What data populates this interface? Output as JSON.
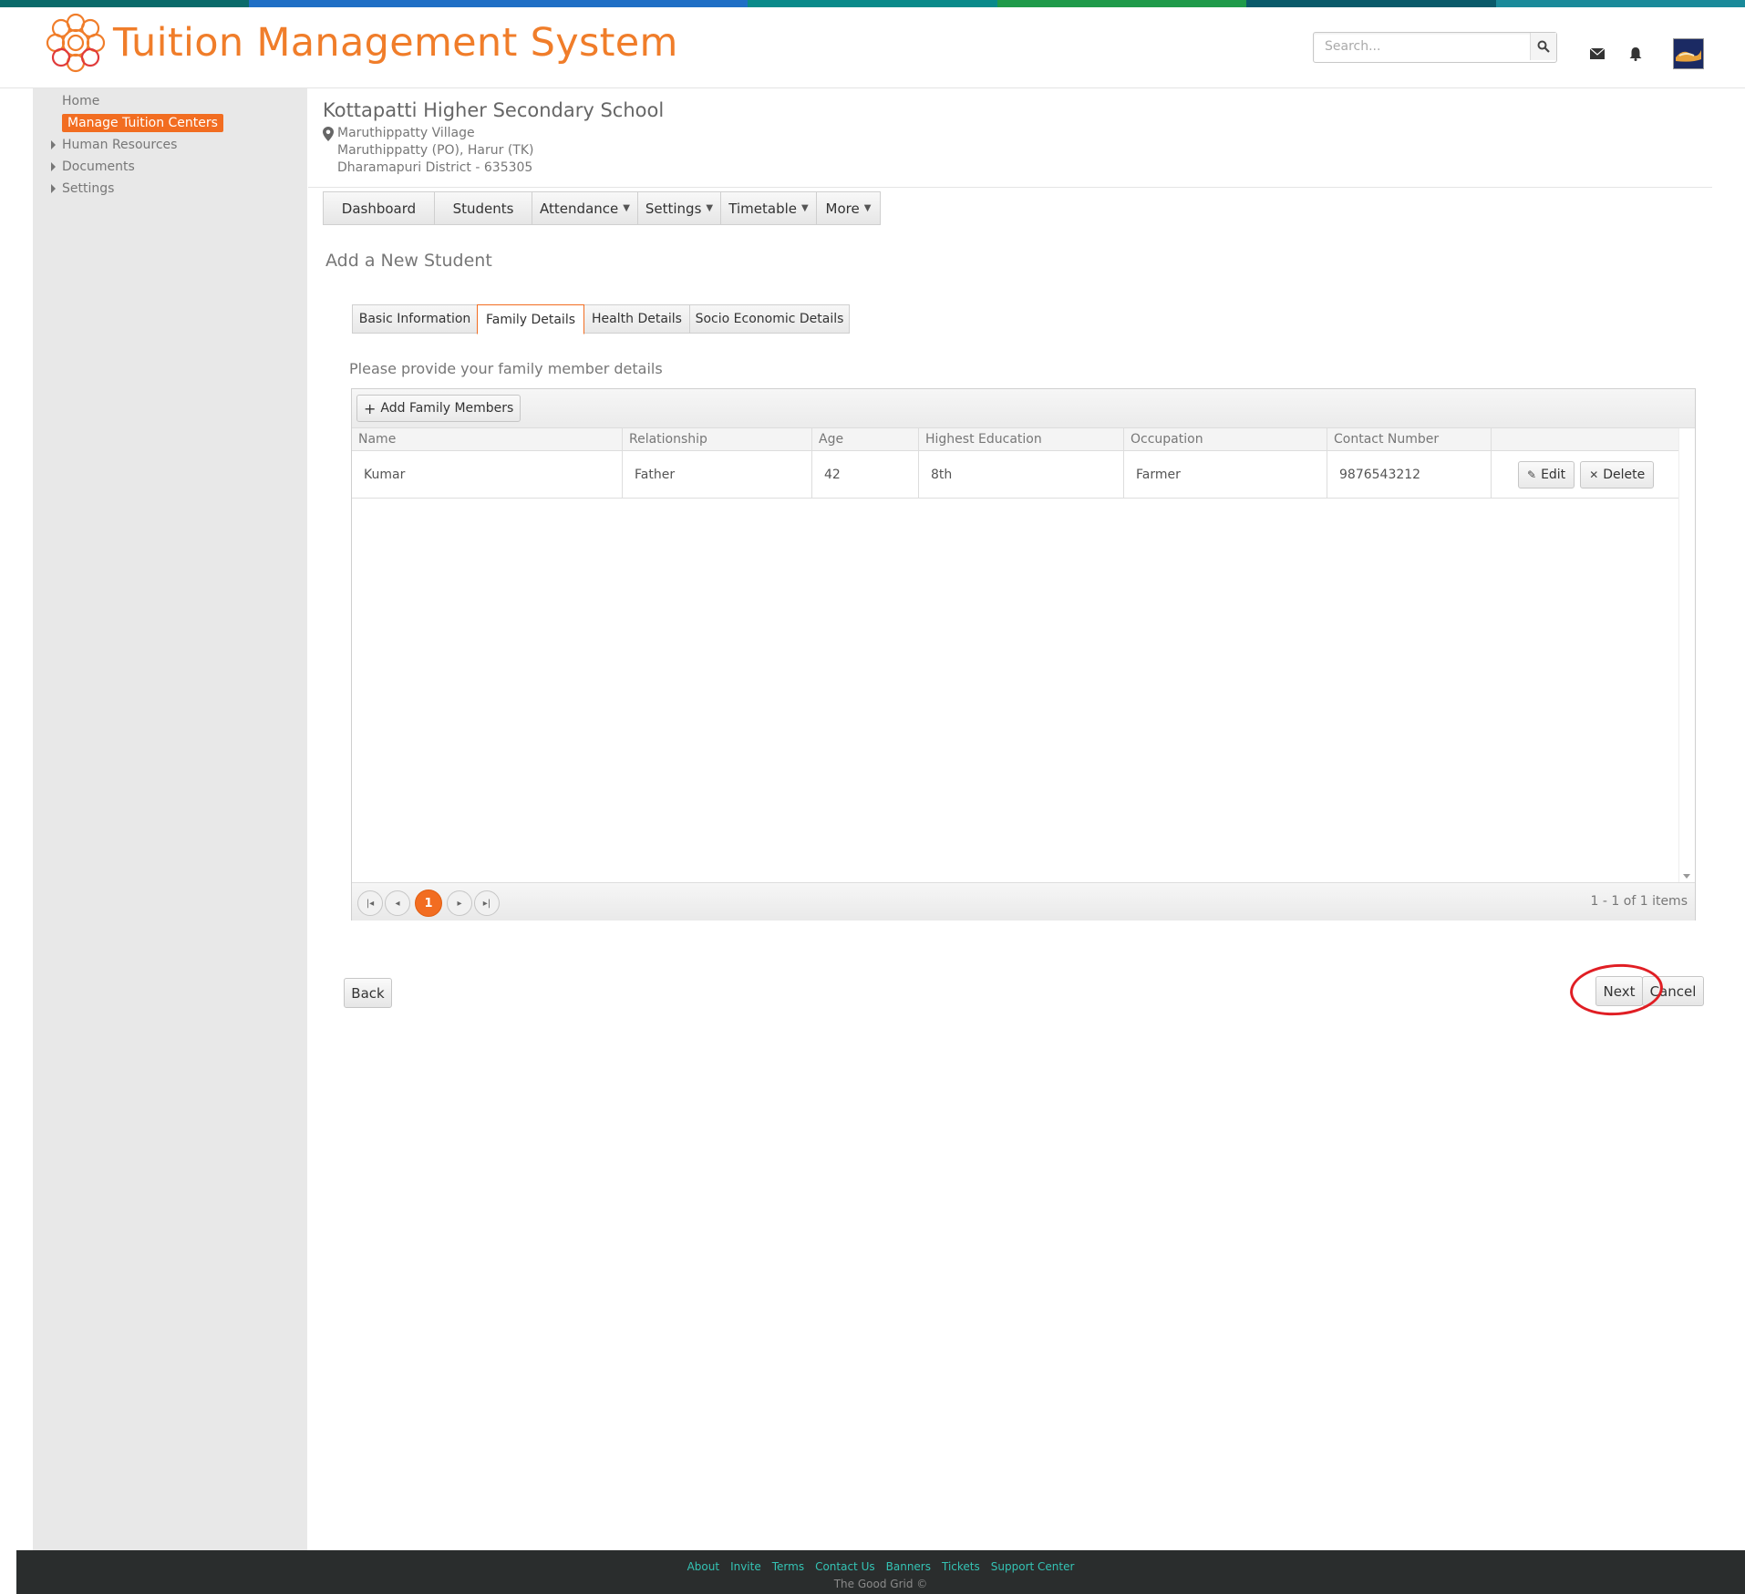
{
  "colors": {
    "accent": "#f26d21",
    "title": "#f07d2a",
    "topbar": [
      "#0a6a6a",
      "#1f6fc5",
      "#1f6fc5",
      "#0a8a8a",
      "#1f9a4a",
      "#0a5a6a",
      "#1a8a9a"
    ],
    "footer_link": "#34c3b4",
    "annotation": "#e01e24"
  },
  "header": {
    "app_title": "Tuition Management System",
    "logo_icon": "flower-logo-icon",
    "search_placeholder": "Search...",
    "search_icon": "search-icon",
    "mail_icon": "envelope-icon",
    "bell_icon": "bell-icon",
    "avatar_icon": "user-avatar"
  },
  "sidebar": {
    "home": "Home",
    "active": "Manage Tuition  Centers",
    "items": [
      "Human Resources",
      "Documents",
      "Settings"
    ]
  },
  "school": {
    "name": "Kottapatti Higher Secondary School",
    "address": [
      "Maruthippatty Village",
      "Maruthippatty (PO), Harur (TK)",
      "Dharamapuri District - 635305"
    ]
  },
  "menu": [
    {
      "label": "Dashboard",
      "dropdown": false
    },
    {
      "label": "Students",
      "dropdown": false
    },
    {
      "label": "Attendance",
      "dropdown": true
    },
    {
      "label": "Settings",
      "dropdown": true
    },
    {
      "label": "Timetable",
      "dropdown": true
    },
    {
      "label": "More",
      "dropdown": true
    }
  ],
  "page_title": "Add a New Student",
  "tabs": [
    {
      "label": "Basic Information",
      "active": false
    },
    {
      "label": "Family Details",
      "active": true
    },
    {
      "label": "Health Details",
      "active": false
    },
    {
      "label": "Socio Economic Details",
      "active": false
    }
  ],
  "section_label": "Please provide your family member details",
  "grid": {
    "add_button": "Add Family Members",
    "columns": [
      "Name",
      "Relationship",
      "Age",
      "Highest Education",
      "Occupation",
      "Contact Number",
      ""
    ],
    "rows": [
      {
        "name": "Kumar",
        "relationship": "Father",
        "age": "42",
        "education": "8th",
        "occupation": "Farmer",
        "contact": "9876543212"
      }
    ],
    "edit_label": "Edit",
    "delete_label": "Delete",
    "pager": {
      "current_page": "1",
      "info": "1 - 1 of 1 items"
    }
  },
  "actions": {
    "back": "Back",
    "next": "Next",
    "cancel": "Cancel"
  },
  "footer": {
    "links": [
      "About",
      "Invite",
      "Terms",
      "Contact Us",
      "Banners",
      "Tickets",
      "Support Center"
    ],
    "copyright": "The Good Grid ©"
  }
}
